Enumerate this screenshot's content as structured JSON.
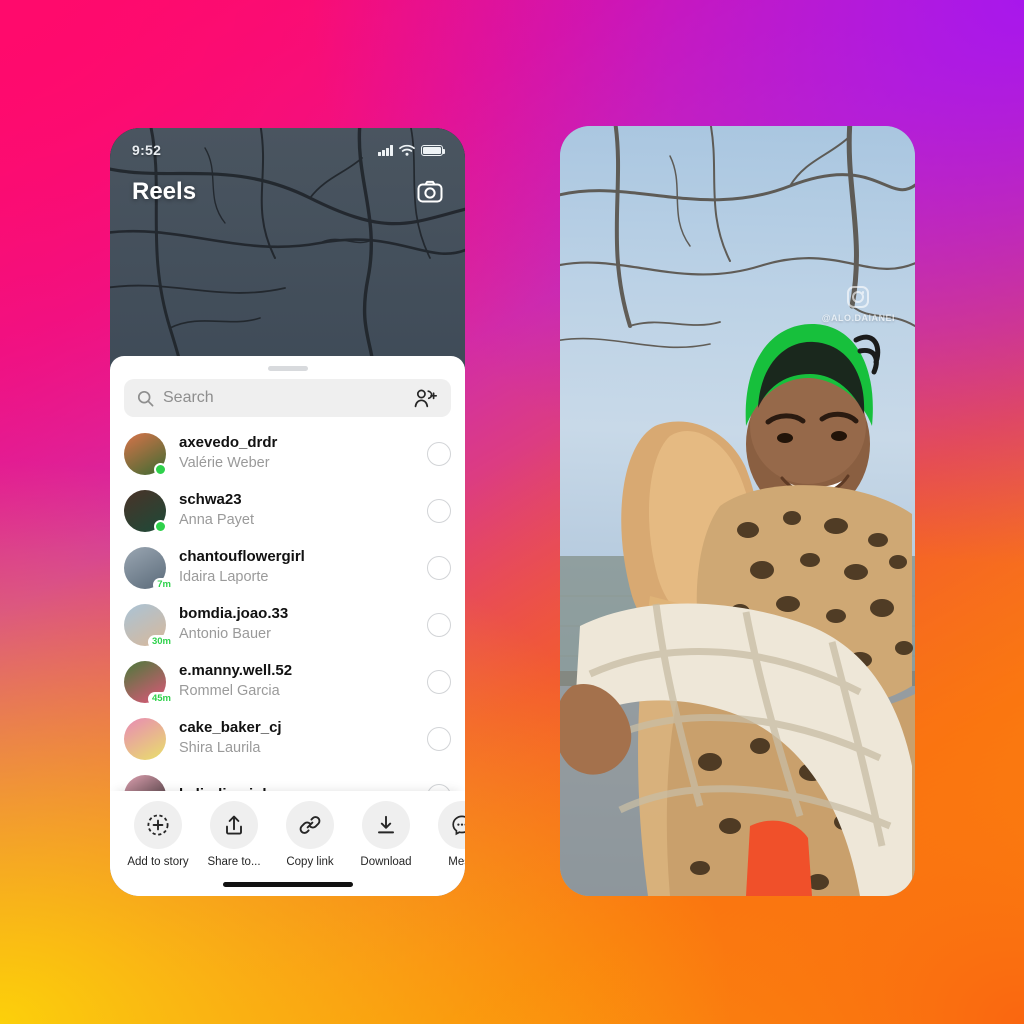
{
  "background": {
    "gradient_colors": [
      "#ff0a6c",
      "#a817ec",
      "#fa6610",
      "#fcd00a"
    ]
  },
  "left_phone": {
    "status_bar": {
      "time": "9:52",
      "signal_icon": "cellular-signal-icon",
      "wifi_icon": "wifi-icon",
      "battery_icon": "battery-icon"
    },
    "header": {
      "title": "Reels",
      "camera_icon": "camera-icon"
    },
    "share_sheet": {
      "grabber": "drag-handle",
      "search": {
        "placeholder": "Search",
        "search_icon": "search-icon",
        "add_people_icon": "add-people-icon"
      },
      "contacts": [
        {
          "username": "axevedo_drdr",
          "fullname": "Valérie Weber",
          "status": "online",
          "badge": "",
          "avatar_colors": [
            "#d8734a",
            "#3e6b32"
          ]
        },
        {
          "username": "schwa23",
          "fullname": "Anna Payet",
          "status": "online",
          "badge": "",
          "avatar_colors": [
            "#4a3228",
            "#1d4a38"
          ]
        },
        {
          "username": "chantouflowergirl",
          "fullname": "Idaira Laporte",
          "status": "time",
          "badge": "7m",
          "avatar_colors": [
            "#9aa6b2",
            "#5b6b7a"
          ]
        },
        {
          "username": "bomdia.joao.33",
          "fullname": "Antonio Bauer",
          "status": "time",
          "badge": "30m",
          "avatar_colors": [
            "#a9c3d6",
            "#d8b89a"
          ]
        },
        {
          "username": "e.manny.well.52",
          "fullname": "Rommel Garcia",
          "status": "time",
          "badge": "45m",
          "avatar_colors": [
            "#4a7a3a",
            "#e0567a"
          ]
        },
        {
          "username": "cake_baker_cj",
          "fullname": "Shira Laurila",
          "status": "none",
          "badge": "",
          "avatar_colors": [
            "#e88ab5",
            "#e8e06a"
          ]
        },
        {
          "username": "kalindi_rainbows",
          "fullname": "",
          "status": "none",
          "badge": "",
          "avatar_colors": [
            "#e0a2b2",
            "#1a1a1a"
          ]
        }
      ],
      "actions": [
        {
          "label": "Add to story",
          "icon": "add-to-story-icon"
        },
        {
          "label": "Share to...",
          "icon": "share-icon"
        },
        {
          "label": "Copy link",
          "icon": "link-icon"
        },
        {
          "label": "Download",
          "icon": "download-icon"
        },
        {
          "label": "Mess",
          "icon": "messenger-icon"
        }
      ]
    },
    "home_indicator": "home-bar"
  },
  "right_phone": {
    "watermark": {
      "instagram_icon": "instagram-logo-icon",
      "handle": "@ALO.DAIANEI"
    },
    "scene_description": "two-people-hugging-outdoors"
  }
}
